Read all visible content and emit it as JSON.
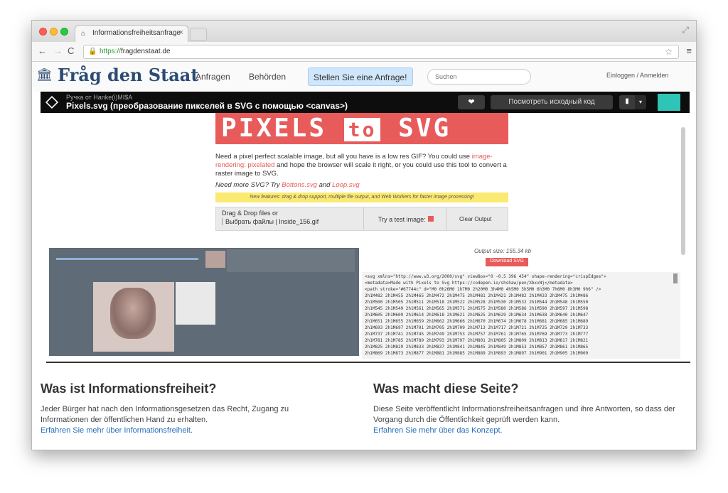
{
  "browser": {
    "tab_title": "Informationsfreiheitsanfrage",
    "url_scheme": "https://",
    "url_host": "fragdenstaat.de"
  },
  "site": {
    "brand": "Fråg den Staat",
    "nav": [
      "Anfragen",
      "Behörden"
    ],
    "cta": "Stellen Sie eine Anfrage!",
    "search_placeholder": "Suchen",
    "login": "Einloggen / Anmelden"
  },
  "pen": {
    "author": "Ручка от Hanke(i)MI$A",
    "title": "Pixels.svg (преобразование пикселей в SVG с помощью <canvas>)",
    "source_button": "Посмотреть исходный код",
    "hero_left": "PIXELS",
    "hero_mid": "to",
    "hero_right": "SVG",
    "intro_1": "Need a pixel perfect scalable image, but all you have is a low res GIF? You could use",
    "intro_link": "image-rendering: pixelated",
    "intro_2": "and hope the browser will scale it right, or you could use this tool to convert a raster image to SVG.",
    "more_text": "Need more SVG? Try",
    "more_link_1": "Bottons.svg",
    "more_and": "and",
    "more_link_2": "Loop.svg",
    "notice": "New features: drag & drop support, multiple file output, and Web Workers for faster image processing!",
    "drop_title": "Drag & Drop files or",
    "drop_file": "Выбрать файлы | Inside_156.gif",
    "test_image": "Try a test image:",
    "clear": "Clear Output",
    "output_info": "Output size: 155.34 kb",
    "download": "Download SVG",
    "code": "<svg xmlns=\"http://www.w3.org/2000/svg\" viewBox=\"0 -0.5 396 454\" shape-rendering=\"crispEdges\">\n<metadata>Made with Pixels to Svg https://codepen.io/shshaw/pen/XbxvNj</metadata>\n<path stroke=\"#67744c\" d=\"M0 0h26M0 1h7M0 2h20M0 3h4M0 4h5M0 5h5M0 6h3M0 7h6M0 8h3M0 9h6\" />\n2h1M482 2h1M455 2h1M465 2h1M472 2h1M475 2h1M481 2h1M421 2h1M482 2h1M433 2h1M475 2h1M486\n2h1M500 2h1M505 2h1M511 2h1M518 2h1M522 2h1M528 2h1M530 2h1M532 2h1M544 2h1M548 2h1M550\n2h1M545 2h1M549 2h1M561 2h1M565 2h1M571 2h1M575 2h1M580 2h1M586 2h1M590 2h1M597 2h1M598\n2h1M605 2h1M609 2h1M614 2h1M618 2h1M621 2h1M625 2h1M629 2h1M634 2h1M638 2h1M640 2h1M647\n2h1M651 2h1M655 2h1M659 2h1M662 2h1M666 2h1M670 2h1M674 2h1M678 2h1M681 2h1M685 2h1M689\n2h1M693 2h1M697 2h1M701 2h1M705 2h1M709 2h1M713 2h1M717 2h1M721 2h1M725 2h1M729 2h1M733\n2h1M737 2h1M741 2h1M745 2h1M749 2h1M753 2h1M757 2h1M761 2h1M765 2h1M769 2h1M773 2h1M777\n2h1M781 2h1M785 2h1M789 2h1M793 2h1M797 2h1M801 2h1M805 2h1M809 2h1M813 2h1M817 2h1M821\n2h1M825 2h1M829 2h1M833 2h1M837 2h1M841 2h1M845 2h1M849 2h1M853 2h1M857 2h1M861 2h1M865\n2h1M869 2h1M873 2h1M877 2h1M881 2h1M885 2h1M889 2h1M893 2h1M897 2h1M901 2h1M905 2h1M909"
  },
  "sections": {
    "left_title": "Was ist Informationsfreiheit?",
    "left_text": "Jeder Bürger hat nach den Informationsgesetzen das Recht, Zugang zu Informationen der öffentlichen Hand zu erhalten.",
    "left_link": "Erfahren Sie mehr über Informationsfreiheit.",
    "right_title": "Was macht diese Seite?",
    "right_text": "Diese Seite veröffentlicht Informationsfreiheitsanfragen und ihre Antworten, so dass der Vorgang durch die Öffentlichkeit geprüft werden kann.",
    "right_link": "Erfahren Sie mehr über das Konzept."
  },
  "colors": {
    "brand": "#2c4b73",
    "accent": "#e85b5b",
    "link": "#2a6ebb"
  }
}
